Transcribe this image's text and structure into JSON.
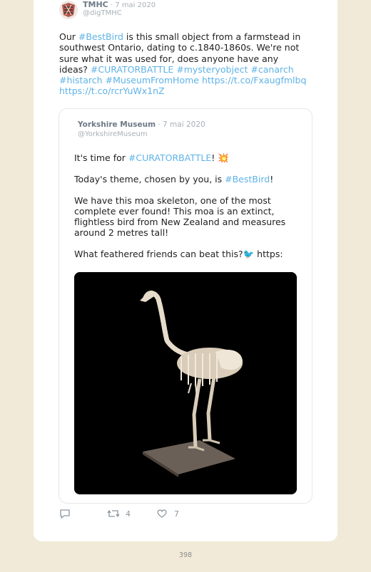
{
  "tweet": {
    "author_name": "TMHC",
    "date": " · 7 mai 2020",
    "handle": "@digTMHC",
    "text_segments": [
      {
        "t": "Our ",
        "link": false
      },
      {
        "t": "#BestBird",
        "link": true
      },
      {
        "t": " is this small object from a farmstead in southwest Ontario, dating to c.1840-1860s. We're not sure what it was used for, does anyone have any ideas? ",
        "link": false
      },
      {
        "t": "#CURATORBATTLE",
        "link": true
      },
      {
        "t": " ",
        "link": false
      },
      {
        "t": "#mysteryobject",
        "link": true
      },
      {
        "t": " ",
        "link": false
      },
      {
        "t": "#canarch",
        "link": true
      },
      {
        "t": " ",
        "link": false
      },
      {
        "t": "#histarch",
        "link": true
      },
      {
        "t": " ",
        "link": false
      },
      {
        "t": "#MuseumFromHome",
        "link": true
      },
      {
        "t": " ",
        "link": false
      },
      {
        "t": "https://t.co/Fxaugfmlbq",
        "link": true
      },
      {
        "t": " ",
        "link": false
      },
      {
        "t": "https://t.co/rcrYuWx1nZ",
        "link": true
      }
    ]
  },
  "quote": {
    "author_name": "Yorkshire Museum",
    "date": " · 7 mai 2020",
    "handle": "@YorkshireMuseum",
    "p1_a": "It's time for ",
    "p1_link": "#CURATORBATTLE",
    "p1_b": "! 💥",
    "p2_a": "Today's theme, chosen by you, is ",
    "p2_link": "#BestBird",
    "p2_b": "!",
    "p3": "We have this moa skeleton, one of the most complete ever found! This moa is an extinct, flightless bird from New Zealand and measures around 2 metres tall!",
    "p4": "What feathered friends can beat this?🐦 https:"
  },
  "actions": {
    "reply_icon": "reply-icon",
    "retweet_icon": "retweet-icon",
    "retweet_count": "4",
    "like_icon": "heart-icon",
    "like_count": "7"
  },
  "footer": {
    "page_number": "398"
  },
  "colors": {
    "background": "#f1ead8",
    "card": "#ffffff",
    "link": "#5fb3e6",
    "muted": "#8a96a1"
  }
}
